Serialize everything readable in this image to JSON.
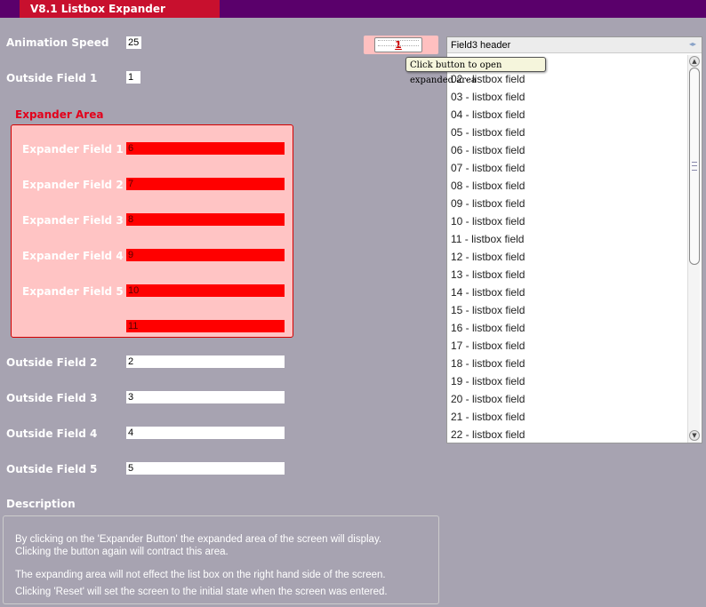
{
  "window": {
    "title": "V8.1 Listbox Expander"
  },
  "animation_speed": {
    "label": "Animation Speed",
    "value": "25"
  },
  "outside_field_1": {
    "label": "Outside Field 1",
    "value": "1"
  },
  "expander": {
    "title": "Expander Area",
    "fields": [
      {
        "label": "Expander Field 1",
        "value": "6"
      },
      {
        "label": "Expander Field 2",
        "value": "7"
      },
      {
        "label": "Expander Field 3",
        "value": "8"
      },
      {
        "label": "Expander Field 4",
        "value": "9"
      },
      {
        "label": "Expander Field 5",
        "value": "10"
      },
      {
        "label": "",
        "value": "11"
      }
    ],
    "button_label": "1",
    "tooltip": "Click button to open expanded area",
    "colors": {
      "area_bg": "#ffc4c4",
      "field_bg": "#ff0000",
      "border": "#d40000"
    }
  },
  "outside_fields": [
    {
      "label": "Outside Field 2",
      "value": "2"
    },
    {
      "label": "Outside Field 3",
      "value": "3"
    },
    {
      "label": "Outside Field 4",
      "value": "4"
    },
    {
      "label": "Outside Field 5",
      "value": "5"
    }
  ],
  "listbox": {
    "header": "Field3 header",
    "items": [
      "02 - listbox field",
      "03 - listbox field",
      "04 - listbox field",
      "05 - listbox field",
      "06 - listbox field",
      "07 - listbox field",
      "08 - listbox field",
      "09 - listbox field",
      "10 - listbox field",
      "11 - listbox field",
      "12 - listbox field",
      "13 - listbox field",
      "14 - listbox field",
      "15 - listbox field",
      "16 - listbox field",
      "17 - listbox field",
      "18 - listbox field",
      "19 - listbox field",
      "20 - listbox field",
      "21 - listbox field",
      "22 - listbox field"
    ]
  },
  "description": {
    "title": "Description",
    "paragraph_1_line_1": "By clicking on the 'Expander Button' the expanded area of the screen will display.",
    "paragraph_1_line_2": "Clicking the button again will contract this area.",
    "paragraph_2": "The expanding area will not effect the list box on the right hand side of the screen.",
    "paragraph_3": "Clicking 'Reset' will set the screen to the initial state when the screen was entered."
  },
  "colors": {
    "background": "#a7a3b1",
    "titlebar": "#5a006b",
    "title_tab": "#c8102e"
  }
}
